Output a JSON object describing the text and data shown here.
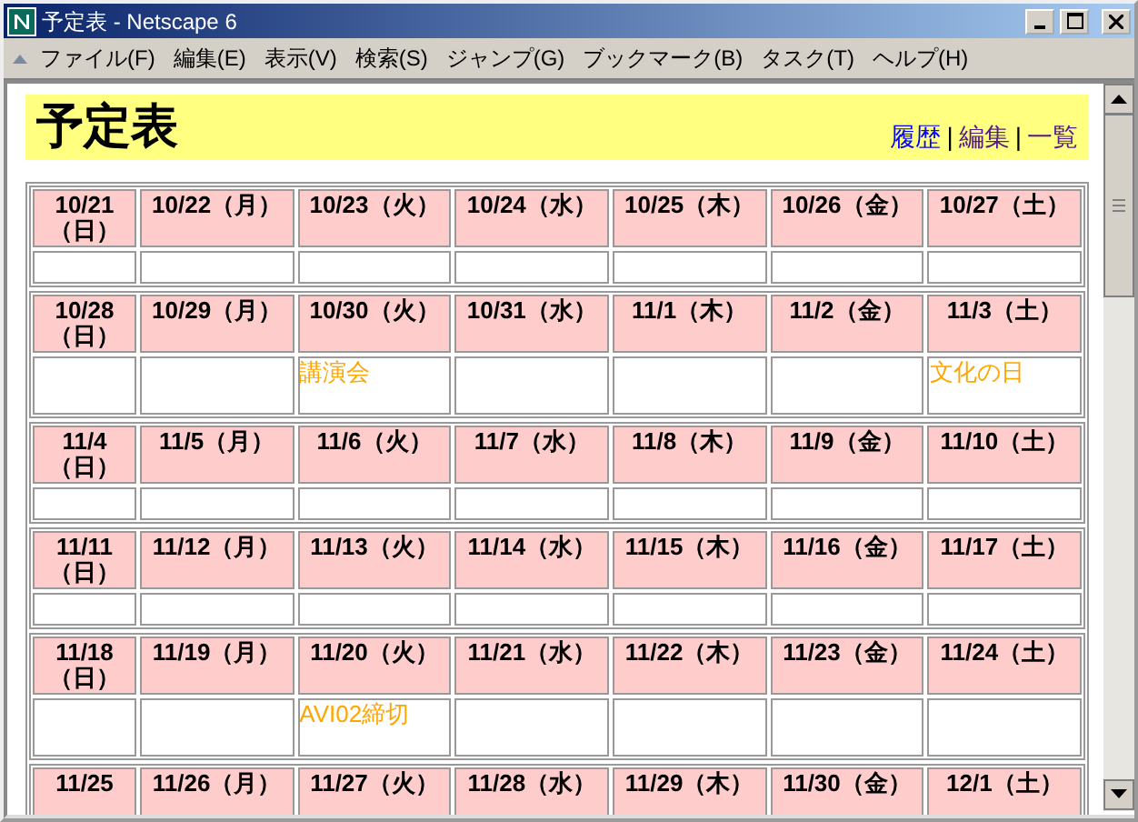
{
  "window": {
    "title": "予定表 - Netscape 6"
  },
  "menu": [
    "ファイル(F)",
    "編集(E)",
    "表示(V)",
    "検索(S)",
    "ジャンプ(G)",
    "ブックマーク(B)",
    "タスク(T)",
    "ヘルプ(H)"
  ],
  "page": {
    "title": "予定表",
    "separators": [
      "|",
      "|"
    ],
    "links": [
      {
        "label": "履歴",
        "visited": false
      },
      {
        "label": "編集",
        "visited": true
      },
      {
        "label": "一覧",
        "visited": true
      }
    ]
  },
  "weeks": [
    {
      "kind": "full",
      "days": [
        {
          "date": "10/21（日）"
        },
        {
          "date": "10/22（月）"
        },
        {
          "date": "10/23（火）"
        },
        {
          "date": "10/24（水）"
        },
        {
          "date": "10/25（木）"
        },
        {
          "date": "10/26（金）"
        },
        {
          "date": "10/27（土）"
        }
      ]
    },
    {
      "kind": "full",
      "days": [
        {
          "date": "10/28（日）"
        },
        {
          "date": "10/29（月）"
        },
        {
          "date": "10/30（火）",
          "event": "講演会"
        },
        {
          "date": "10/31（水）"
        },
        {
          "date": "11/1（木）"
        },
        {
          "date": "11/2（金）"
        },
        {
          "date": "11/3（土）",
          "event": "文化の日"
        }
      ]
    },
    {
      "kind": "full",
      "days": [
        {
          "date": "11/4（日）"
        },
        {
          "date": "11/5（月）"
        },
        {
          "date": "11/6（火）"
        },
        {
          "date": "11/7（水）"
        },
        {
          "date": "11/8（木）"
        },
        {
          "date": "11/9（金）"
        },
        {
          "date": "11/10（土）"
        }
      ]
    },
    {
      "kind": "full",
      "days": [
        {
          "date": "11/11（日）"
        },
        {
          "date": "11/12（月）"
        },
        {
          "date": "11/13（火）"
        },
        {
          "date": "11/14（水）"
        },
        {
          "date": "11/15（木）"
        },
        {
          "date": "11/16（金）"
        },
        {
          "date": "11/17（土）"
        }
      ]
    },
    {
      "kind": "full",
      "days": [
        {
          "date": "11/18（日）"
        },
        {
          "date": "11/19（月）"
        },
        {
          "date": "11/20（火）",
          "event": "AVI02締切"
        },
        {
          "date": "11/21（水）"
        },
        {
          "date": "11/22（木）"
        },
        {
          "date": "11/23（金）"
        },
        {
          "date": "11/24（土）"
        }
      ]
    },
    {
      "kind": "cut",
      "days": [
        {
          "date": "11/25"
        },
        {
          "date": "11/26（月）"
        },
        {
          "date": "11/27（火）"
        },
        {
          "date": "11/28（水）"
        },
        {
          "date": "11/29（木）"
        },
        {
          "date": "11/30（金）"
        },
        {
          "date": "12/1（土）"
        }
      ]
    }
  ]
}
